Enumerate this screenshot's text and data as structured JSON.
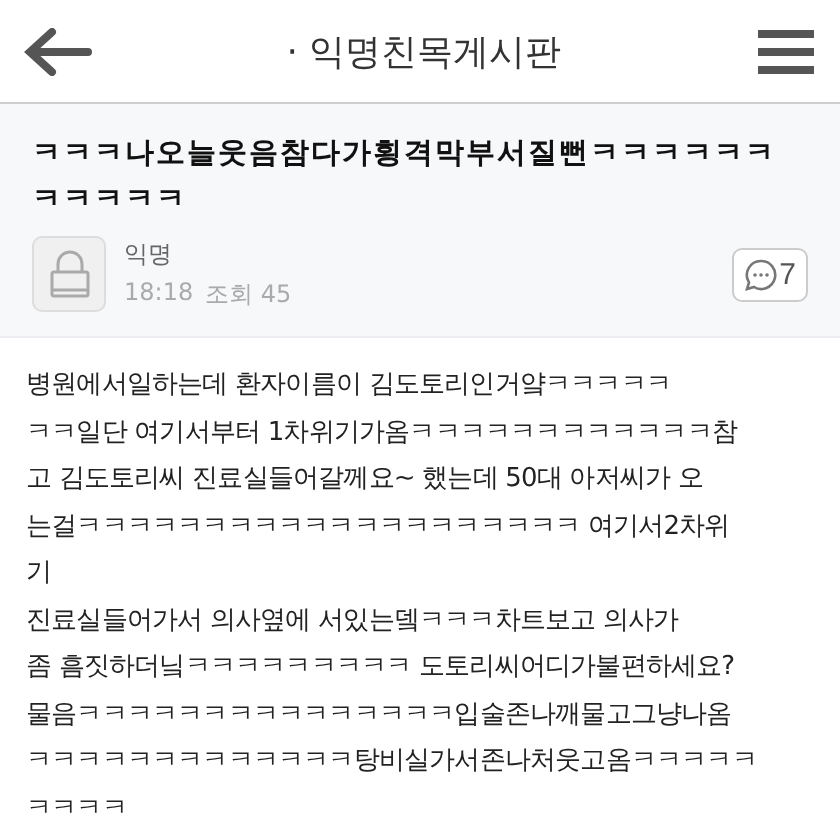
{
  "header": {
    "title": "· 익명친목게시판"
  },
  "post": {
    "title_lines": [
      "ㅋㅋㅋ나오늘웃음참다가횡격막부서질뻔ㅋㅋㅋㅋㅋㅋ",
      "ㅋㅋㅋㅋㅋ"
    ],
    "author": "익명",
    "time": "18:18",
    "views": "조회 45",
    "comments": "7",
    "body_lines": [
      "병원에서일하는데 환자이름이 김도토리인거얔ㅋㅋㅋㅋㅋ",
      "ㅋㅋ일단 여기서부터 1차위기가옴ㅋㅋㅋㅋㅋㅋㅋㅋㅋㅋㅋㅋ참",
      "고 김도토리씨 진료실들어갈께요~ 했는데 50대 아저씨가 오",
      "는걸ㅋㅋㅋㅋㅋㅋㅋㅋㅋㅋㅋㅋㅋㅋㅋㅋㅋㅋㅋㅋ 여기서2차위",
      "기",
      "진료실들어가서 의사옆에 서있는뎈ㅋㅋㅋ차트보고 의사가",
      "좀 흠짓하더닠ㅋㅋㅋㅋㅋㅋㅋㅋㅋ 도토리씨어디가불편하세요?",
      "물음ㅋㅋㅋㅋㅋㅋㅋㅋㅋㅋㅋㅋㅋㅋㅋ입술존나깨물고그냥나옴",
      "ㅋㅋㅋㅋㅋㅋㅋㅋㅋㅋㅋㅋㅋ탕비실가서존나처웃고옴ㅋㅋㅋㅋㅋ",
      "ㅋㅋㅋㅋ"
    ]
  }
}
